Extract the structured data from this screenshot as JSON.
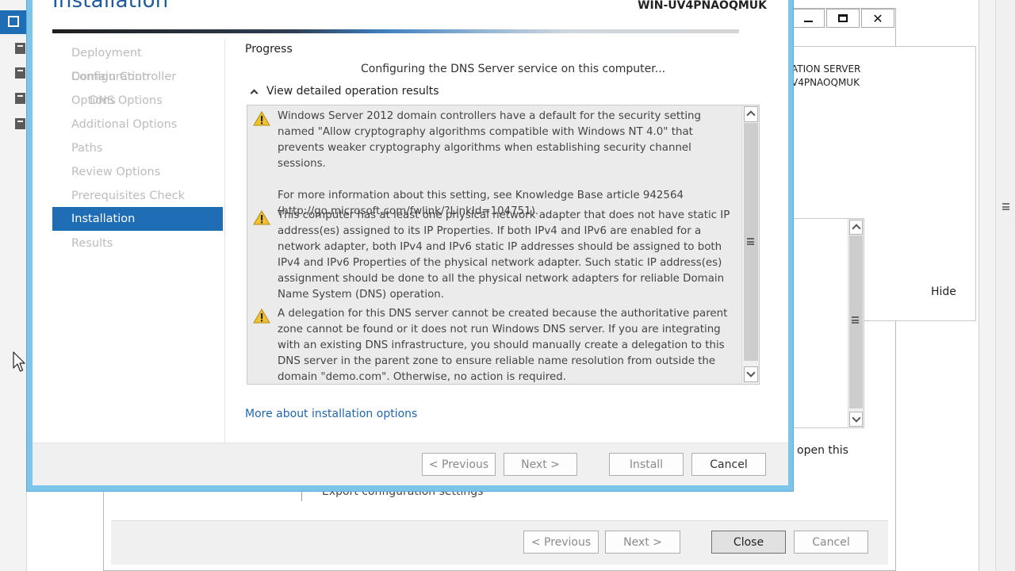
{
  "front_wizard": {
    "title": "Installation",
    "server_name": "WIN-UV4PNAOQMUK",
    "nav": [
      {
        "label": "Deployment Configuration",
        "state": "disabled"
      },
      {
        "label": "Domain Controller Options",
        "state": "disabled"
      },
      {
        "label": "DNS Options",
        "state": "disabled",
        "sub": true
      },
      {
        "label": "Additional Options",
        "state": "disabled"
      },
      {
        "label": "Paths",
        "state": "disabled"
      },
      {
        "label": "Review Options",
        "state": "disabled"
      },
      {
        "label": "Prerequisites Check",
        "state": "disabled"
      },
      {
        "label": "Installation",
        "state": "active"
      },
      {
        "label": "Results",
        "state": "disabled"
      }
    ],
    "progress_label": "Progress",
    "status_text": "Configuring the DNS Server service on this computer...",
    "details_toggle": "View detailed operation results",
    "messages": [
      {
        "icon": "warning-icon",
        "text": "Windows Server 2012 domain controllers have a default for the security setting named \"Allow cryptography algorithms compatible with Windows NT 4.0\" that prevents weaker cryptography algorithms when establishing security channel sessions.\n\nFor more information about this setting, see Knowledge Base article 942564 (http://go.microsoft.com/fwlink/?LinkId=104751)."
      },
      {
        "icon": "warning-icon",
        "text": "This computer has at least one physical network adapter that does not have static IP address(es) assigned to its IP Properties. If both IPv4 and IPv6 are enabled for a network adapter, both IPv4 and IPv6 static IP addresses should be assigned to both IPv4 and IPv6 Properties of the physical network adapter. Such static IP address(es) assignment should be done to all the physical network adapters for reliable Domain Name System (DNS) operation."
      },
      {
        "icon": "warning-icon",
        "text": "A delegation for this DNS server cannot be created because the authoritative parent zone cannot be found or it does not run Windows DNS server. If you are integrating with an existing DNS infrastructure, you should manually create a delegation to this DNS server in the parent zone to ensure reliable name resolution from outside the domain \"demo.com\". Otherwise, no action is required."
      }
    ],
    "more_link": "More about installation options",
    "buttons": {
      "previous": "< Previous",
      "next": "Next >",
      "install": "Install",
      "cancel": "Cancel"
    }
  },
  "back_wizard": {
    "target_line1": "ATION SERVER",
    "target_line2": "V4PNAOQMUK",
    "hide": "Hide",
    "open_this": "open this",
    "export": "Export configuration settings",
    "titlebar": {
      "close_glyph": "✕"
    },
    "buttons": {
      "previous": "< Previous",
      "next": "Next >",
      "close": "Close",
      "cancel": "Cancel"
    }
  },
  "colors": {
    "accent": "#1f6db5",
    "title": "#1e5aa0",
    "frame": "#7cc4ea",
    "warning": "#f2c12e",
    "link": "#1f66b0"
  }
}
